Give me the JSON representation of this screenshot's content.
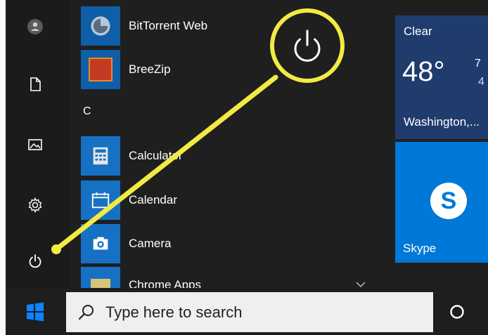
{
  "start_menu": {
    "apps": [
      {
        "name": "BitTorrent Web",
        "icon": "bittorrent-icon"
      },
      {
        "name": "BreeZip",
        "icon": "breezip-icon"
      },
      {
        "name": "Calculator",
        "icon": "calculator-icon"
      },
      {
        "name": "Calendar",
        "icon": "calendar-icon"
      },
      {
        "name": "Camera",
        "icon": "camera-icon"
      },
      {
        "name": "Chrome Apps",
        "icon": "folder-icon"
      }
    ],
    "group_letter": "C",
    "rail_icons": [
      "user-avatar-icon",
      "document-icon",
      "pictures-icon",
      "settings-gear-icon",
      "power-icon"
    ]
  },
  "tiles": {
    "weather": {
      "condition": "Clear",
      "temp": "48°",
      "high": "7",
      "low": "4",
      "location": "Washington,..."
    },
    "skype": {
      "label": "Skype",
      "letter": "S"
    }
  },
  "taskbar": {
    "search_placeholder": "Type here to search",
    "icons": [
      "windows-logo-icon",
      "search-magnifier-icon",
      "cortana-circle-icon"
    ]
  },
  "annotation": {
    "highlight_color": "#f3ea43",
    "callout_icon": "power-icon"
  },
  "colors": {
    "start_bg": "#1f1f1f",
    "accent_blue": "#0078d7",
    "weather_blue": "#1f3c6d",
    "taskbar": "#1e1e1e"
  }
}
